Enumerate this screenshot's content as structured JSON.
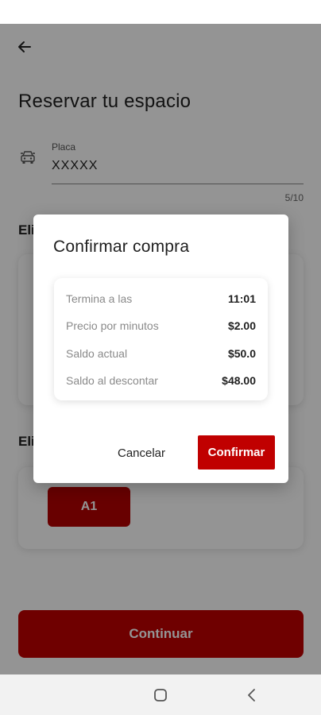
{
  "header": {
    "title": "Reservar tu espacio"
  },
  "plate": {
    "label": "Placa",
    "value": "XXXXX",
    "counter": "5/10"
  },
  "sections": {
    "first_heading": "Eli",
    "second_heading": "Eli"
  },
  "spot": {
    "label": "A1"
  },
  "continue_label": "Continuar",
  "dialog": {
    "title": "Confirmar compra",
    "rows": [
      {
        "label": "Termina a las",
        "value": "11:01"
      },
      {
        "label": "Precio por minutos",
        "value": "$2.00"
      },
      {
        "label": "Saldo actual",
        "value": "$50.0"
      },
      {
        "label": "Saldo al descontar",
        "value": "$48.00"
      }
    ],
    "cancel_label": "Cancelar",
    "confirm_label": "Confirmar"
  },
  "colors": {
    "accent": "#c00000",
    "scrim": "rgba(0,0,0,0.42)"
  },
  "icons": {
    "back": "arrow-left-icon",
    "plate": "car-front-icon",
    "nav_home": "square-home-icon",
    "nav_back": "chevron-left-icon"
  }
}
